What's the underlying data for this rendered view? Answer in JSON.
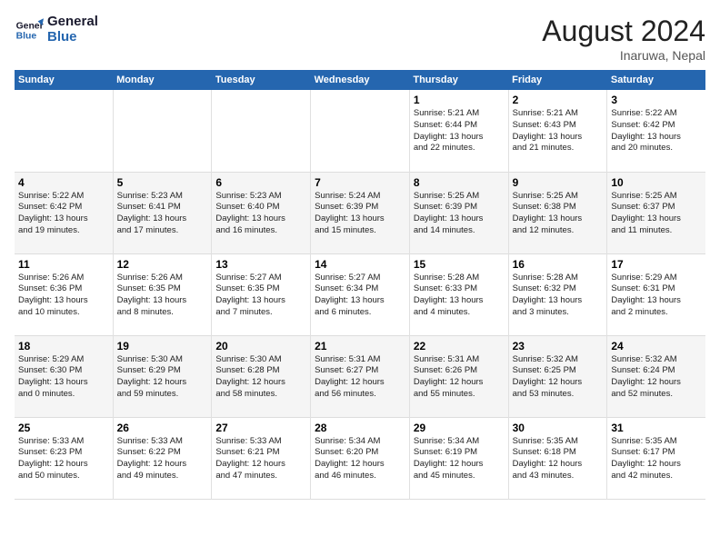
{
  "logo": {
    "line1": "General",
    "line2": "Blue"
  },
  "title": "August 2024",
  "location": "Inaruwa, Nepal",
  "days_header": [
    "Sunday",
    "Monday",
    "Tuesday",
    "Wednesday",
    "Thursday",
    "Friday",
    "Saturday"
  ],
  "weeks": [
    [
      {
        "day": "",
        "info": ""
      },
      {
        "day": "",
        "info": ""
      },
      {
        "day": "",
        "info": ""
      },
      {
        "day": "",
        "info": ""
      },
      {
        "day": "1",
        "info": "Sunrise: 5:21 AM\nSunset: 6:44 PM\nDaylight: 13 hours\nand 22 minutes."
      },
      {
        "day": "2",
        "info": "Sunrise: 5:21 AM\nSunset: 6:43 PM\nDaylight: 13 hours\nand 21 minutes."
      },
      {
        "day": "3",
        "info": "Sunrise: 5:22 AM\nSunset: 6:42 PM\nDaylight: 13 hours\nand 20 minutes."
      }
    ],
    [
      {
        "day": "4",
        "info": "Sunrise: 5:22 AM\nSunset: 6:42 PM\nDaylight: 13 hours\nand 19 minutes."
      },
      {
        "day": "5",
        "info": "Sunrise: 5:23 AM\nSunset: 6:41 PM\nDaylight: 13 hours\nand 17 minutes."
      },
      {
        "day": "6",
        "info": "Sunrise: 5:23 AM\nSunset: 6:40 PM\nDaylight: 13 hours\nand 16 minutes."
      },
      {
        "day": "7",
        "info": "Sunrise: 5:24 AM\nSunset: 6:39 PM\nDaylight: 13 hours\nand 15 minutes."
      },
      {
        "day": "8",
        "info": "Sunrise: 5:25 AM\nSunset: 6:39 PM\nDaylight: 13 hours\nand 14 minutes."
      },
      {
        "day": "9",
        "info": "Sunrise: 5:25 AM\nSunset: 6:38 PM\nDaylight: 13 hours\nand 12 minutes."
      },
      {
        "day": "10",
        "info": "Sunrise: 5:25 AM\nSunset: 6:37 PM\nDaylight: 13 hours\nand 11 minutes."
      }
    ],
    [
      {
        "day": "11",
        "info": "Sunrise: 5:26 AM\nSunset: 6:36 PM\nDaylight: 13 hours\nand 10 minutes."
      },
      {
        "day": "12",
        "info": "Sunrise: 5:26 AM\nSunset: 6:35 PM\nDaylight: 13 hours\nand 8 minutes."
      },
      {
        "day": "13",
        "info": "Sunrise: 5:27 AM\nSunset: 6:35 PM\nDaylight: 13 hours\nand 7 minutes."
      },
      {
        "day": "14",
        "info": "Sunrise: 5:27 AM\nSunset: 6:34 PM\nDaylight: 13 hours\nand 6 minutes."
      },
      {
        "day": "15",
        "info": "Sunrise: 5:28 AM\nSunset: 6:33 PM\nDaylight: 13 hours\nand 4 minutes."
      },
      {
        "day": "16",
        "info": "Sunrise: 5:28 AM\nSunset: 6:32 PM\nDaylight: 13 hours\nand 3 minutes."
      },
      {
        "day": "17",
        "info": "Sunrise: 5:29 AM\nSunset: 6:31 PM\nDaylight: 13 hours\nand 2 minutes."
      }
    ],
    [
      {
        "day": "18",
        "info": "Sunrise: 5:29 AM\nSunset: 6:30 PM\nDaylight: 13 hours\nand 0 minutes."
      },
      {
        "day": "19",
        "info": "Sunrise: 5:30 AM\nSunset: 6:29 PM\nDaylight: 12 hours\nand 59 minutes."
      },
      {
        "day": "20",
        "info": "Sunrise: 5:30 AM\nSunset: 6:28 PM\nDaylight: 12 hours\nand 58 minutes."
      },
      {
        "day": "21",
        "info": "Sunrise: 5:31 AM\nSunset: 6:27 PM\nDaylight: 12 hours\nand 56 minutes."
      },
      {
        "day": "22",
        "info": "Sunrise: 5:31 AM\nSunset: 6:26 PM\nDaylight: 12 hours\nand 55 minutes."
      },
      {
        "day": "23",
        "info": "Sunrise: 5:32 AM\nSunset: 6:25 PM\nDaylight: 12 hours\nand 53 minutes."
      },
      {
        "day": "24",
        "info": "Sunrise: 5:32 AM\nSunset: 6:24 PM\nDaylight: 12 hours\nand 52 minutes."
      }
    ],
    [
      {
        "day": "25",
        "info": "Sunrise: 5:33 AM\nSunset: 6:23 PM\nDaylight: 12 hours\nand 50 minutes."
      },
      {
        "day": "26",
        "info": "Sunrise: 5:33 AM\nSunset: 6:22 PM\nDaylight: 12 hours\nand 49 minutes."
      },
      {
        "day": "27",
        "info": "Sunrise: 5:33 AM\nSunset: 6:21 PM\nDaylight: 12 hours\nand 47 minutes."
      },
      {
        "day": "28",
        "info": "Sunrise: 5:34 AM\nSunset: 6:20 PM\nDaylight: 12 hours\nand 46 minutes."
      },
      {
        "day": "29",
        "info": "Sunrise: 5:34 AM\nSunset: 6:19 PM\nDaylight: 12 hours\nand 45 minutes."
      },
      {
        "day": "30",
        "info": "Sunrise: 5:35 AM\nSunset: 6:18 PM\nDaylight: 12 hours\nand 43 minutes."
      },
      {
        "day": "31",
        "info": "Sunrise: 5:35 AM\nSunset: 6:17 PM\nDaylight: 12 hours\nand 42 minutes."
      }
    ]
  ]
}
